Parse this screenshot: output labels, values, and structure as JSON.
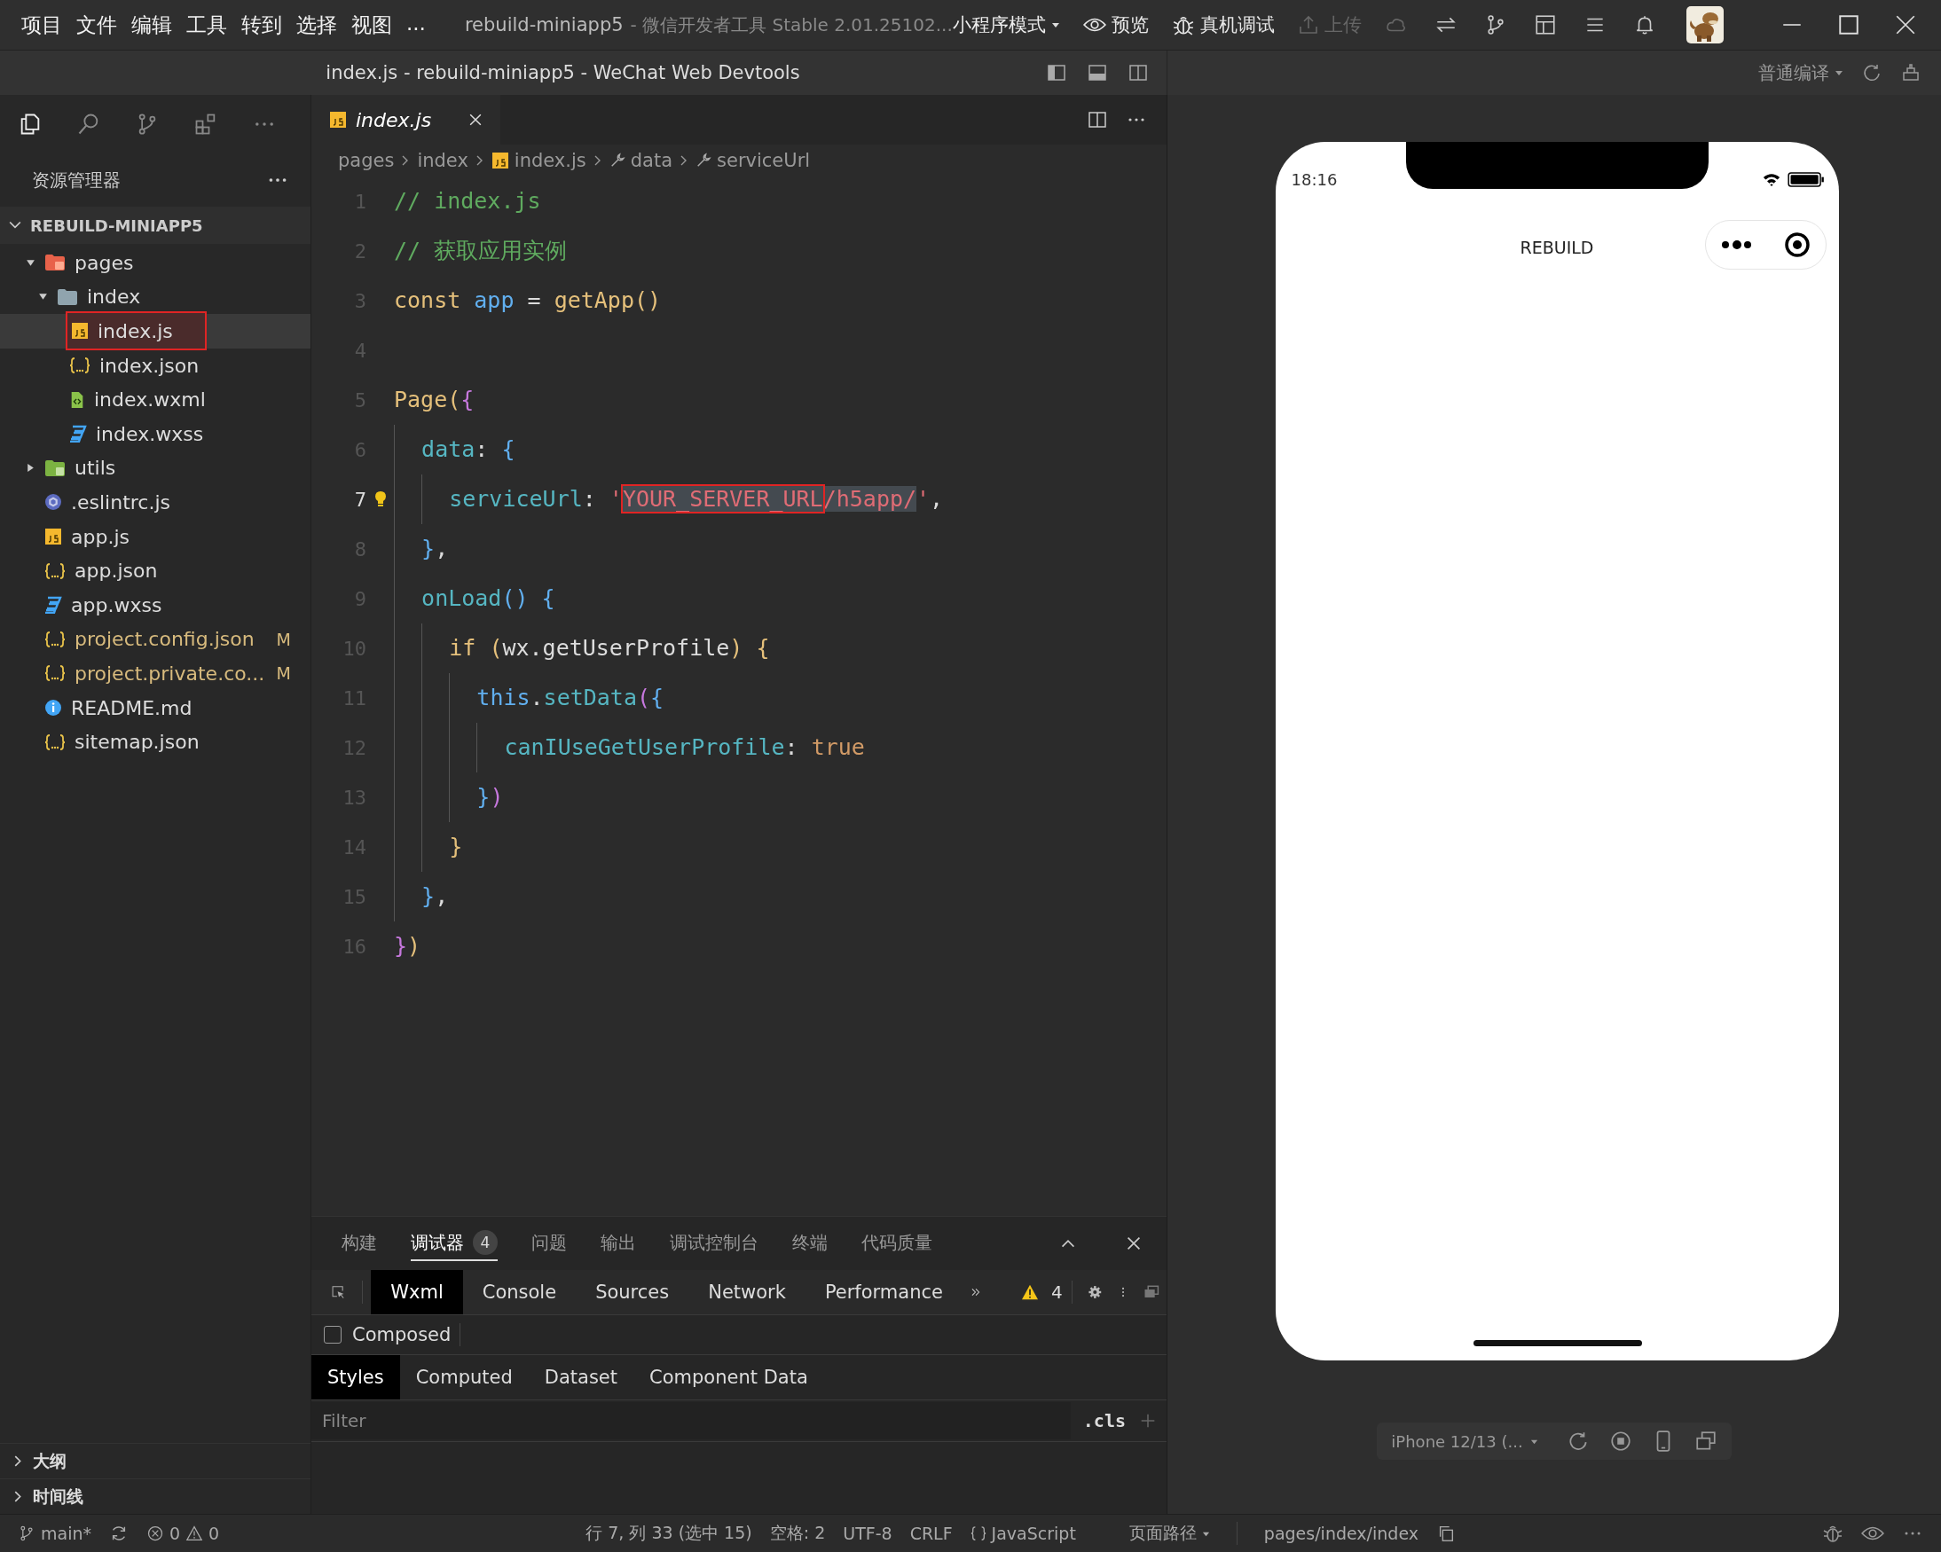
{
  "menu_bar": {
    "items": [
      "项目",
      "文件",
      "编辑",
      "工具",
      "转到",
      "选择",
      "视图",
      "..."
    ],
    "app_title": "rebuild-miniapp5",
    "app_subtitle": "- 微信开发者工具 Stable 2.01.25102...",
    "mode": "小程序模式",
    "actions": [
      {
        "kind": "preview",
        "label": "预览",
        "disabled": false
      },
      {
        "kind": "debug",
        "label": "真机调试",
        "disabled": false
      },
      {
        "kind": "upload",
        "label": "上传",
        "disabled": true
      }
    ]
  },
  "window_title": "index.js - rebuild-miniapp5 - WeChat Web Devtools",
  "compile_mode": "普通编译",
  "sidebar": {
    "title": "资源管理器",
    "section": {
      "label": "REBUILD-MINIAPP5",
      "expanded": true
    },
    "tree": [
      {
        "name": "pages",
        "kind": "folder-pages",
        "expanded": true,
        "selected": false,
        "children": [
          {
            "name": "index",
            "kind": "folder",
            "expanded": true,
            "selected": false,
            "children": [
              {
                "name": "index.js",
                "kind": "js",
                "selected": true
              },
              {
                "name": "index.json",
                "kind": "json",
                "selected": false
              },
              {
                "name": "index.wxml",
                "kind": "wxml",
                "selected": false
              },
              {
                "name": "index.wxss",
                "kind": "wxss",
                "selected": false
              }
            ]
          }
        ]
      },
      {
        "name": "utils",
        "kind": "folder-utils",
        "expanded": false,
        "selected": false
      },
      {
        "name": ".eslintrc.js",
        "kind": "eslint",
        "selected": false
      },
      {
        "name": "app.js",
        "kind": "js",
        "selected": false
      },
      {
        "name": "app.json",
        "kind": "json",
        "selected": false
      },
      {
        "name": "app.wxss",
        "kind": "wxss",
        "selected": false
      },
      {
        "name": "project.config.json",
        "kind": "json",
        "selected": false,
        "badge": "M"
      },
      {
        "name": "project.private.co...",
        "kind": "json",
        "selected": false,
        "badge": "M"
      },
      {
        "name": "README.md",
        "kind": "info",
        "selected": false
      },
      {
        "name": "sitemap.json",
        "kind": "json",
        "selected": false
      }
    ],
    "bottom_sections": [
      {
        "label": "大纲",
        "expanded": false
      },
      {
        "label": "时间线",
        "expanded": false
      }
    ]
  },
  "editor": {
    "tab": {
      "label": "index.js"
    },
    "breadcrumb": [
      {
        "kind": "folder",
        "label": "pages"
      },
      {
        "kind": "folder",
        "label": "index"
      },
      {
        "kind": "js",
        "label": "index.js"
      },
      {
        "kind": "property",
        "label": "data"
      },
      {
        "kind": "property",
        "label": "serviceUrl"
      }
    ],
    "lines": [
      {
        "number": "1",
        "current": false,
        "tokens": [
          {
            "kind": "comment",
            "text": "// index.js"
          }
        ]
      },
      {
        "number": "2",
        "current": false,
        "tokens": [
          {
            "kind": "comment",
            "text": "// 获取应用实例"
          }
        ]
      },
      {
        "number": "3",
        "current": false,
        "tokens": [
          {
            "kind": "keyword",
            "text": "const "
          },
          {
            "kind": "variable",
            "text": "app"
          },
          {
            "kind": "plain",
            "text": " = "
          },
          {
            "kind": "function",
            "text": "getApp"
          },
          {
            "kind": "bracket1",
            "text": "()"
          }
        ]
      },
      {
        "number": "4",
        "current": false
      },
      {
        "number": "5",
        "current": false,
        "tokens": [
          {
            "kind": "function",
            "text": "Page"
          },
          {
            "kind": "bracket1",
            "text": "("
          },
          {
            "kind": "bracket2",
            "text": "{"
          }
        ]
      },
      {
        "number": "6",
        "current": false,
        "tokens": [
          {
            "kind": "property",
            "text": "  data"
          },
          {
            "kind": "plain",
            "text": ": "
          },
          {
            "kind": "bracket3",
            "text": "{"
          }
        ]
      },
      {
        "number": "7",
        "current": true,
        "tokens": [
          {
            "kind": "property",
            "text": "    serviceUrl",
            "selected": false,
            "boxed": false
          },
          {
            "kind": "plain",
            "text": ": ",
            "selected": false,
            "boxed": false
          },
          {
            "kind": "string",
            "text": "'",
            "selected": false,
            "boxed": false
          },
          {
            "kind": "string",
            "text": "YOUR_SERVER_URL",
            "selected": true,
            "boxed": true
          },
          {
            "kind": "string",
            "text": "/h5app/",
            "selected": true,
            "boxed": false
          },
          {
            "kind": "string",
            "text": "'",
            "selected": false,
            "boxed": false
          },
          {
            "kind": "plain",
            "text": ",",
            "selected": false,
            "boxed": false
          }
        ]
      },
      {
        "number": "8",
        "current": false,
        "tokens": [
          {
            "kind": "bracket3",
            "text": "  }"
          },
          {
            "kind": "plain",
            "text": ","
          }
        ]
      },
      {
        "number": "9",
        "current": false,
        "tokens": [
          {
            "kind": "property",
            "text": "  onLoad"
          },
          {
            "kind": "bracket3",
            "text": "()"
          },
          {
            "kind": "bracket3",
            "text": " {"
          }
        ]
      },
      {
        "number": "10",
        "current": false,
        "tokens": [
          {
            "kind": "keyword",
            "text": "    if "
          },
          {
            "kind": "bracket1",
            "text": "("
          },
          {
            "kind": "plain",
            "text": "wx.getUserProfile"
          },
          {
            "kind": "bracket1",
            "text": ")"
          },
          {
            "kind": "bracket1",
            "text": " {"
          }
        ]
      },
      {
        "number": "11",
        "current": false,
        "tokens": [
          {
            "kind": "this",
            "text": "      this"
          },
          {
            "kind": "plain",
            "text": "."
          },
          {
            "kind": "property",
            "text": "setData"
          },
          {
            "kind": "bracket2",
            "text": "("
          },
          {
            "kind": "bracket3",
            "text": "{"
          }
        ]
      },
      {
        "number": "12",
        "current": false,
        "tokens": [
          {
            "kind": "property",
            "text": "        canIUseGetUserProfile"
          },
          {
            "kind": "plain",
            "text": ": "
          },
          {
            "kind": "boolean",
            "text": "true"
          }
        ]
      },
      {
        "number": "13",
        "current": false,
        "tokens": [
          {
            "kind": "bracket3",
            "text": "      }"
          },
          {
            "kind": "bracket2",
            "text": ")"
          }
        ]
      },
      {
        "number": "14",
        "current": false,
        "tokens": [
          {
            "kind": "bracket1",
            "text": "    }"
          }
        ]
      },
      {
        "number": "15",
        "current": false,
        "tokens": [
          {
            "kind": "bracket3",
            "text": "  }"
          },
          {
            "kind": "plain",
            "text": ","
          }
        ]
      },
      {
        "number": "16",
        "current": false,
        "tokens": [
          {
            "kind": "bracket2",
            "text": "}"
          },
          {
            "kind": "bracket1",
            "text": ")"
          }
        ]
      }
    ]
  },
  "panel": {
    "tabs": [
      {
        "label": "构建",
        "selected": false
      },
      {
        "label": "调试器",
        "selected": true,
        "badge": "4"
      },
      {
        "label": "问题",
        "selected": false
      },
      {
        "label": "输出",
        "selected": false
      },
      {
        "label": "调试控制台",
        "selected": false
      },
      {
        "label": "终端",
        "selected": false
      },
      {
        "label": "代码质量",
        "selected": false
      }
    ]
  },
  "devtools": {
    "tabs": [
      {
        "label": "Wxml",
        "selected": true
      },
      {
        "label": "Console",
        "selected": false
      },
      {
        "label": "Sources",
        "selected": false
      },
      {
        "label": "Network",
        "selected": false
      },
      {
        "label": "Performance",
        "selected": false
      }
    ],
    "warnings": "4",
    "composed": {
      "label": "Composed",
      "checked": false
    },
    "style_tabs": [
      {
        "label": "Styles",
        "selected": true
      },
      {
        "label": "Computed",
        "selected": false
      },
      {
        "label": "Dataset",
        "selected": false
      },
      {
        "label": "Component Data",
        "selected": false
      }
    ],
    "filter": {
      "placeholder": "Filter"
    },
    "cls": ".cls"
  },
  "status_bar": {
    "branch": "main*",
    "errors": "0",
    "warnings": "0",
    "position": "行 7, 列 33 (选中 15)",
    "indent": "空格: 2",
    "encoding": "UTF-8",
    "eol": "CRLF",
    "language": "JavaScript",
    "page_path_label": "页面路径",
    "page_path": "pages/index/index"
  },
  "simulator": {
    "time": "18:16",
    "title": "REBUILD",
    "device": "iPhone 12/13 (..."
  }
}
